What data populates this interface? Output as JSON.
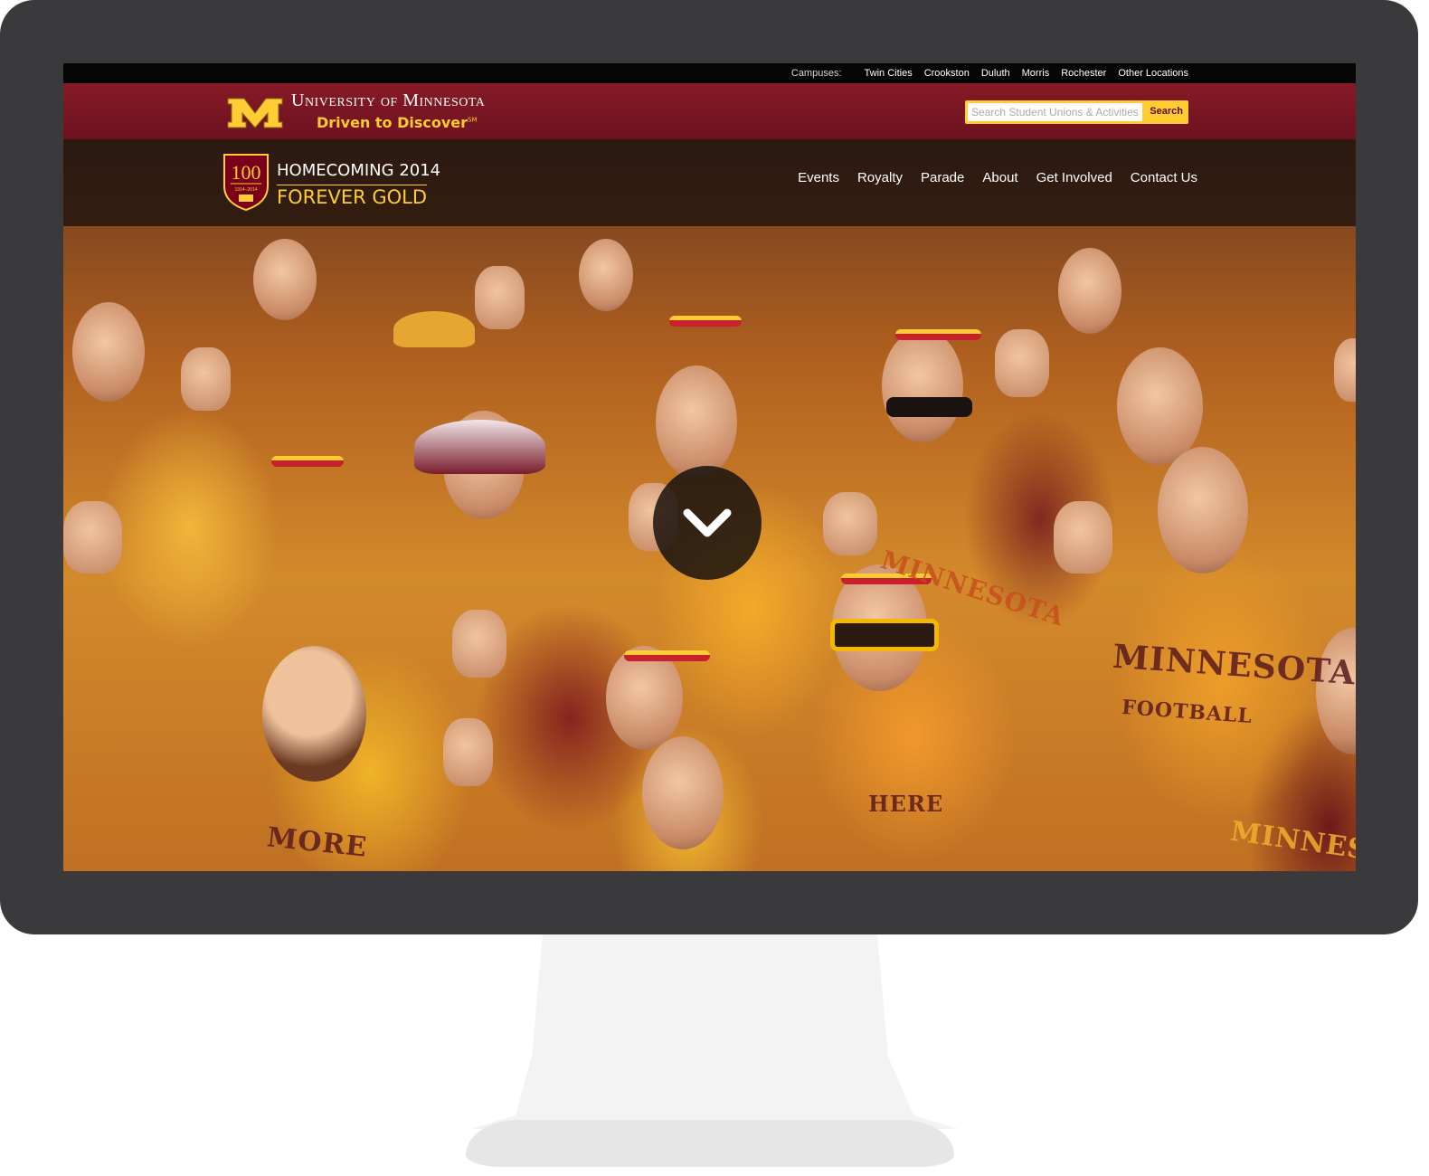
{
  "campus_bar": {
    "label": "Campuses:",
    "links": [
      "Twin Cities",
      "Crookston",
      "Duluth",
      "Morris",
      "Rochester",
      "Other Locations"
    ]
  },
  "header": {
    "university_name": "University of Minnesota",
    "tagline": "Driven to Discover",
    "tagline_mark": "SM",
    "search": {
      "placeholder": "Search Student Unions & Activities",
      "button_label": "Search"
    }
  },
  "homecoming": {
    "badge_number": "100",
    "badge_years": "1914–2014",
    "title": "HOMECOMING 2014",
    "subtitle": "FOREVER GOLD",
    "nav": [
      "Events",
      "Royalty",
      "Parade",
      "About",
      "Get Involved",
      "Contact Us"
    ]
  },
  "hero": {
    "scroll_icon": "chevron-down-icon"
  },
  "colors": {
    "maroon": "#7a0019",
    "gold": "#ffcc33",
    "frame": "#3a3a3c"
  }
}
